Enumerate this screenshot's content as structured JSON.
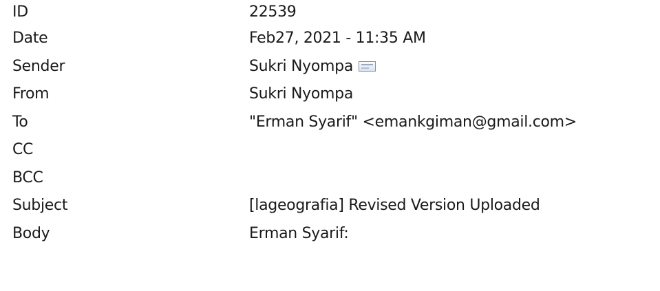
{
  "message": {
    "fields": [
      {
        "label": "ID",
        "value": "22539"
      },
      {
        "label": "Date",
        "value": "Feb27, 2021 - 11:35 AM"
      },
      {
        "label": "Sender",
        "value": "Sukri Nyompa"
      },
      {
        "label": "From",
        "value": "Sukri Nyompa"
      },
      {
        "label": "To",
        "value": "\"Erman Syarif\" <emankgiman@gmail.com>"
      },
      {
        "label": "CC",
        "value": ""
      },
      {
        "label": "BCC",
        "value": ""
      },
      {
        "label": "Subject",
        "value": "[lageografia] Revised Version Uploaded"
      },
      {
        "label": "Body",
        "value": "Erman Syarif:"
      }
    ],
    "sender_icon": "envelope-icon"
  }
}
